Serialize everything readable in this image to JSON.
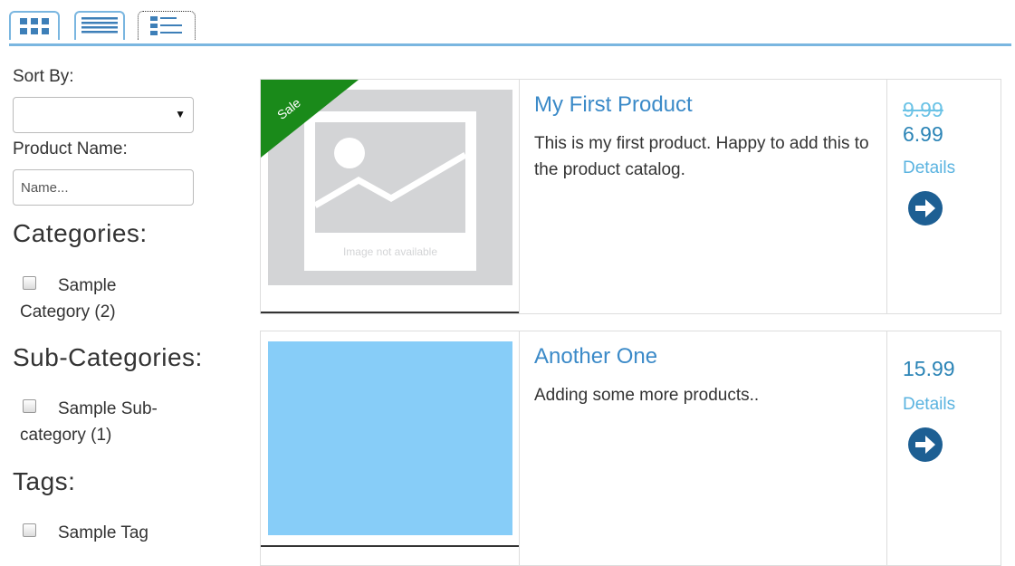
{
  "view_toggles": [
    {
      "name": "grid-view",
      "icon": "grid-icon"
    },
    {
      "name": "list-view",
      "icon": "list-icon"
    },
    {
      "name": "detail-view",
      "icon": "detail-list-icon"
    }
  ],
  "sidebar": {
    "sort_label": "Sort By:",
    "sort_value": "",
    "product_name_label": "Product Name:",
    "product_name_placeholder": "Name...",
    "categories_heading": "Categories:",
    "category_items": [
      {
        "label": "Sample Category (2)",
        "checked": false
      }
    ],
    "subcategories_heading": "Sub-Categories:",
    "subcategory_items": [
      {
        "label": "Sample Sub-category (1)",
        "checked": false
      }
    ],
    "tags_heading": "Tags:",
    "tag_items": [
      {
        "label": "Sample Tag",
        "checked": false
      }
    ]
  },
  "products": [
    {
      "title": "My First Product",
      "description": "This is my first product. Happy to add this to the product catalog.",
      "badge": "Sale",
      "image_placeholder_text": "Image not available",
      "old_price": "9.99",
      "price": "6.99",
      "details_label": "Details"
    },
    {
      "title": "Another One",
      "description": "Adding some more products..",
      "price": "15.99",
      "details_label": "Details"
    }
  ],
  "colors": {
    "accent": "#7ab6e0",
    "link": "#3b8ac8",
    "sale_badge": "#1a8a1a",
    "image_light_blue": "#87cdf8",
    "placeholder_gray": "#d3d4d6",
    "arrow_button": "#1d5f93"
  }
}
